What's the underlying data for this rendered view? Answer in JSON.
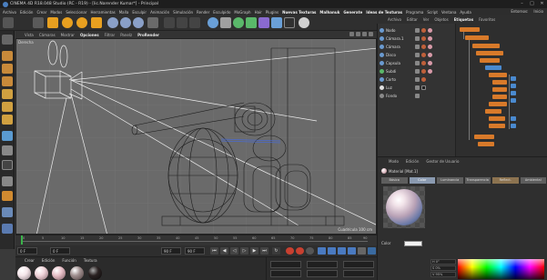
{
  "window": {
    "title": "CINEMA 4D R18.048 Studio (RC - R19) - [lic.Narender Kumar*] - Principal"
  },
  "menubar": {
    "items": [
      {
        "label": "Archivo",
        "hi": false
      },
      {
        "label": "Edición",
        "hi": false
      },
      {
        "label": "Crear",
        "hi": false
      },
      {
        "label": "Modos",
        "hi": false
      },
      {
        "label": "Seleccionar",
        "hi": false
      },
      {
        "label": "Herramientas",
        "hi": false
      },
      {
        "label": "Malla",
        "hi": false
      },
      {
        "label": "Esculpir",
        "hi": false
      },
      {
        "label": "Animación",
        "hi": false
      },
      {
        "label": "Simulación",
        "hi": false
      },
      {
        "label": "Render",
        "hi": false
      },
      {
        "label": "Esculpido",
        "hi": false
      },
      {
        "label": "MoGraph",
        "hi": false
      },
      {
        "label": "Hair",
        "hi": false
      },
      {
        "label": "Plugins",
        "hi": false
      },
      {
        "label": "Nuevas Texturas",
        "hi": true
      },
      {
        "label": "Malhanuk",
        "hi": true
      },
      {
        "label": "Generate",
        "hi": true
      },
      {
        "label": "Ideas de Texturas",
        "hi": true
      },
      {
        "label": "Programa",
        "hi": false
      },
      {
        "label": "Script",
        "hi": false
      },
      {
        "label": "Ventana",
        "hi": false
      },
      {
        "label": "Ayuda",
        "hi": false
      }
    ],
    "right": [
      "Entornos:",
      "Inicio"
    ]
  },
  "viewport_menu": {
    "items": [
      "Vista",
      "Cámaras",
      "Mostrar",
      "Opciones",
      "Filtrar",
      "Panelz",
      "ProRender"
    ],
    "active": "Opciones",
    "label": "Derecha",
    "scale_label": "Cuadrícula 100 cm"
  },
  "timeline": {
    "ticks": [
      "0",
      "5",
      "10",
      "15",
      "20",
      "25",
      "30",
      "35",
      "40",
      "45",
      "50",
      "55",
      "60",
      "65",
      "70",
      "75",
      "80",
      "85",
      "90"
    ],
    "end_label": "0 F"
  },
  "transport": {
    "start_frame": "0 F",
    "current_frame": "0 F",
    "end_frame": "90 F",
    "max_frame": "90 F"
  },
  "material_bar": {
    "tabs": [
      "Crear",
      "Edición",
      "Función",
      "Textura"
    ],
    "materials": [
      {
        "name": "Mat.1",
        "color": "#f5e6ea"
      },
      {
        "name": "Mat.2",
        "color": "#f0d4da"
      },
      {
        "name": "Mat.3",
        "color": "#e8c0c8"
      },
      {
        "name": "Mat.4",
        "color": "#a09090"
      },
      {
        "name": "Mat.5",
        "color": "#2a2222"
      }
    ]
  },
  "object_manager": {
    "tabs": [
      "Archivo",
      "Editar",
      "Ver",
      "Objetos",
      "Etiquetas",
      "Favoritos"
    ],
    "active_tab": "Etiquetas",
    "objects": [
      {
        "name": "Nodo"
      },
      {
        "name": "Cámara.1"
      },
      {
        "name": "Cámara"
      },
      {
        "name": "Disco"
      },
      {
        "name": "Capsula"
      },
      {
        "name": "Subdi"
      },
      {
        "name": "Corto"
      },
      {
        "name": "Luz"
      },
      {
        "name": "Fondo"
      }
    ]
  },
  "attributes": {
    "tabs": [
      "Modo",
      "Edición",
      "Gestor de Usuario"
    ],
    "material_name": "Material [Mat.1]",
    "channels": [
      "Básico",
      "Color",
      "Luminancia",
      "Transparencia",
      "Reflect.",
      "Ambiental"
    ],
    "selected_channel": "Color",
    "color_label": "Color",
    "color_value": "#f2f2f2",
    "hsv": [
      "H 0°",
      "S 0%",
      "V 95%"
    ]
  },
  "colors": {
    "accent_orange": "#d87a2a",
    "accent_blue": "#4a8ad0",
    "timeline_green": "#3ab34a"
  }
}
